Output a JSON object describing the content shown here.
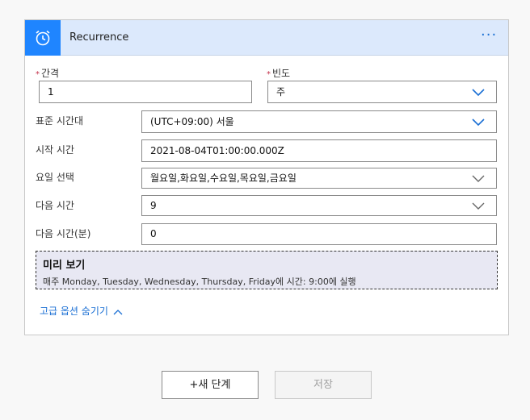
{
  "card": {
    "title": "Recurrence",
    "more_label": "···",
    "icon": "alarm-clock-icon"
  },
  "fields": {
    "interval": {
      "label": "간격",
      "value": "1",
      "required": "*"
    },
    "frequency": {
      "label": "빈도",
      "value": "주",
      "required": "*"
    },
    "timezone": {
      "label": "표준 시간대",
      "value": "(UTC+09:00) 서울"
    },
    "start_time": {
      "label": "시작 시간",
      "value": "2021-08-04T01:00:00.000Z"
    },
    "weekdays": {
      "label": "요일 선택",
      "value": "월요일,화요일,수요일,목요일,금요일"
    },
    "hours": {
      "label": "다음 시간",
      "value": "9"
    },
    "minutes": {
      "label": "다음 시간(분)",
      "value": "0"
    }
  },
  "preview": {
    "title": "미리 보기",
    "text": "매주 Monday, Tuesday, Wednesday, Thursday, Friday에 시간: 9:00에 실행"
  },
  "advanced_label": "고급 옵션 숨기기",
  "buttons": {
    "new_step": "+새 단계",
    "save": "저장"
  },
  "colors": {
    "accent": "#1f85ff",
    "header_bg": "#dce9fc",
    "link": "#1a6fd4"
  }
}
